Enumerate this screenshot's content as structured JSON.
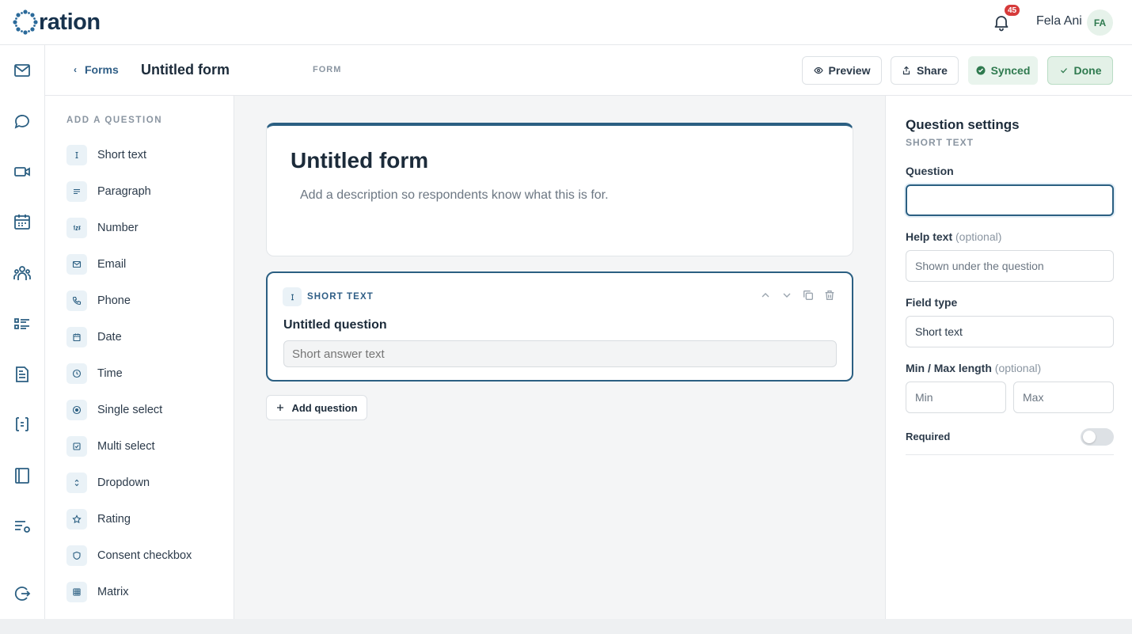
{
  "brand": {
    "name": "ration"
  },
  "header": {
    "notifications_count": "45",
    "user_name": "Fela Ani",
    "user_initials": "FA"
  },
  "rail": {
    "icons": [
      "mail-icon",
      "chat-icon",
      "video-icon",
      "calendar-icon",
      "people-icon",
      "tasks-icon",
      "document-icon",
      "transfer-icon",
      "notebook-icon",
      "settings-list-icon",
      "logout-icon"
    ]
  },
  "subheader": {
    "back_label": "Forms",
    "title": "Untitled form",
    "tag": "FORM",
    "preview_label": "Preview",
    "share_label": "Share",
    "synced_label": "Synced",
    "done_label": "Done"
  },
  "palette": {
    "heading": "ADD A QUESTION",
    "items": [
      {
        "label": "Short text",
        "icon": "text-cursor-icon"
      },
      {
        "label": "Paragraph",
        "icon": "paragraph-icon"
      },
      {
        "label": "Number",
        "icon": "number-icon"
      },
      {
        "label": "Email",
        "icon": "mail-icon"
      },
      {
        "label": "Phone",
        "icon": "phone-icon"
      },
      {
        "label": "Date",
        "icon": "calendar-icon"
      },
      {
        "label": "Time",
        "icon": "clock-icon"
      },
      {
        "label": "Single select",
        "icon": "radio-icon"
      },
      {
        "label": "Multi select",
        "icon": "checkbox-icon"
      },
      {
        "label": "Dropdown",
        "icon": "dropdown-icon"
      },
      {
        "label": "Rating",
        "icon": "star-icon"
      },
      {
        "label": "Consent checkbox",
        "icon": "shield-icon"
      },
      {
        "label": "Matrix",
        "icon": "grid-icon"
      }
    ]
  },
  "form": {
    "title": "Untitled form",
    "description_placeholder": "Add a description so respondents know what this is for."
  },
  "question": {
    "type": "SHORT TEXT",
    "title": "Untitled question",
    "answer_placeholder": "Short answer text"
  },
  "add_question_label": "Add question",
  "settings": {
    "title": "Question settings",
    "subtitle": "SHORT TEXT",
    "question_label": "Question",
    "question_value": "",
    "help_label": "Help text",
    "help_optional": "(optional)",
    "help_placeholder": "Shown under the question",
    "field_type_label": "Field type",
    "field_type_value": "Short text",
    "minmax_label": "Min / Max length",
    "minmax_optional": "(optional)",
    "min_placeholder": "Min",
    "max_placeholder": "Max",
    "required_label": "Required",
    "required_on": false
  },
  "colors": {
    "accent": "#2b5f82",
    "success": "#2f7a4f",
    "badge": "#d63a3a"
  }
}
